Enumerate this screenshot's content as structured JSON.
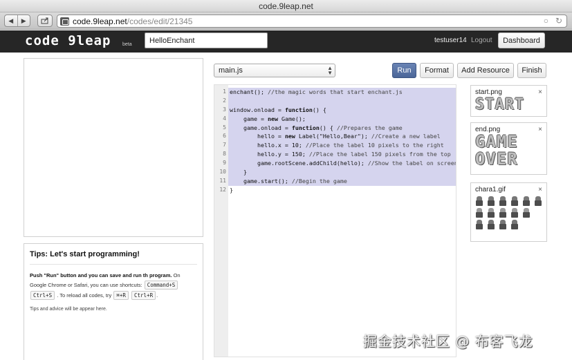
{
  "browser": {
    "window_title": "code.9leap.net",
    "url_host": "code.9leap.net",
    "url_path": "/codes/edit/21345",
    "url_suffix_icon": "reload-icon"
  },
  "header": {
    "logo_text": "code 9leap",
    "logo_beta": "beta",
    "project_name": "HelloEnchant",
    "username": "testuser14",
    "logout_label": "Logout",
    "dashboard_label": "Dashboard"
  },
  "tips": {
    "title": "Tips: Let's start programming!",
    "bold_intro": "Push \"Run\" button and you can save and run th program.",
    "line2": "On Google Chrome or Safari, you can use shortcuts:",
    "shortcut1": "Command+S",
    "shortcut2": "Ctrl+S",
    "line3": ". To reload all codes, try",
    "shortcut3": "⌘+R",
    "shortcut4": "Ctrl+R",
    "line3_end": ".",
    "footer": "Tips and advice will be appear here."
  },
  "editor": {
    "file": "main.js",
    "buttons": {
      "run": "Run",
      "format": "Format",
      "add_resource": "Add Resource",
      "finish": "Finish"
    },
    "lines": [
      "enchant(); //the magic words that start enchant.js",
      "",
      "window.onload = function() {",
      "    game = new Game();",
      "    game.onload = function() { //Prepares the game",
      "        hello = new Label(\"Hello,Bear\"); //Create a new label",
      "        hello.x = 10; //Place the label 10 pixels to the right",
      "        hello.y = 150; //Place the label 150 pixels from the top",
      "        game.rootScene.addChild(hello); //Show the label on screen",
      "    }",
      "    game.start(); //Begin the game",
      "}"
    ]
  },
  "resources": [
    {
      "name": "start.png",
      "art": "START"
    },
    {
      "name": "end.png",
      "art_line1": "GAME",
      "art_line2": "OVER"
    },
    {
      "name": "chara1.gif"
    }
  ],
  "watermark": "掘金技术社区 @ 布客飞龙"
}
